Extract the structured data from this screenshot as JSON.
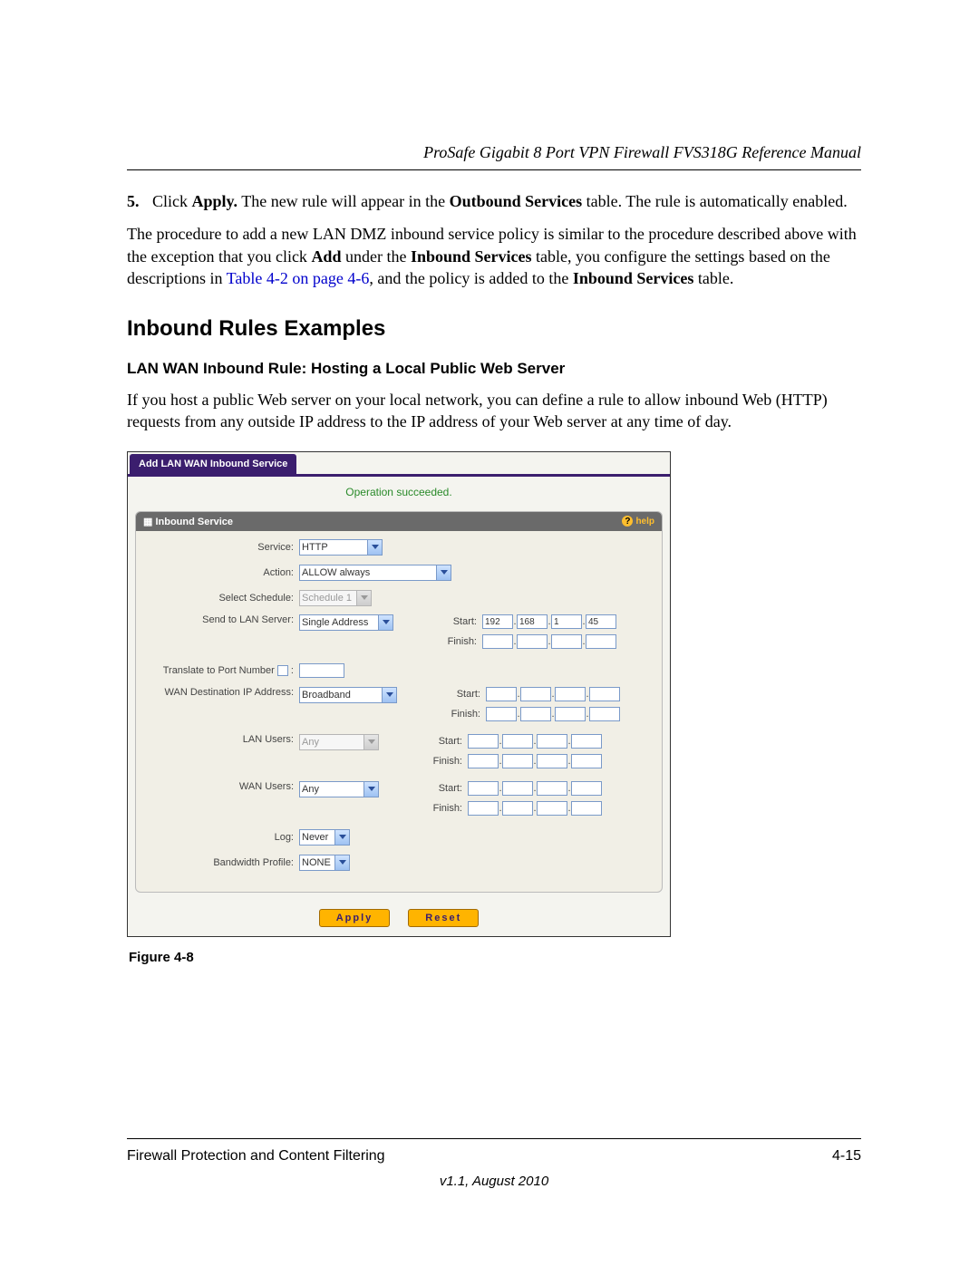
{
  "header": {
    "doc_title": "ProSafe Gigabit 8 Port VPN Firewall FVS318G Reference Manual"
  },
  "step5": {
    "num": "5.",
    "pre": "Click ",
    "apply": "Apply.",
    "mid1": " The new rule will appear in the ",
    "outbound": "Outbound Services",
    "mid2": " table. The rule is automatically enabled."
  },
  "para": {
    "pre": "The procedure to add a new LAN DMZ inbound service policy is similar to the procedure described above with the exception that you click ",
    "add": "Add",
    "mid1": " under the ",
    "inbound1": "Inbound Services",
    "mid2": " table, you configure the settings based on the descriptions in ",
    "link": "Table 4-2 on page 4-6",
    "mid3": ", and the policy is added to the ",
    "inbound2": "Inbound Services",
    "mid4": " table."
  },
  "h1": "Inbound Rules Examples",
  "h2": "LAN WAN Inbound Rule: Hosting a Local Public Web Server",
  "para2": "If you host a public Web server on your local network, you can define a rule to allow inbound Web (HTTP) requests from any outside IP address to the IP address of your Web server at any time of day.",
  "fig_caption": "Figure 4-8",
  "shot": {
    "tab": "Add LAN WAN Inbound Service",
    "status": "Operation succeeded.",
    "panel_title": "Inbound Service",
    "help": "help",
    "labels": {
      "service": "Service:",
      "action": "Action:",
      "schedule": "Select Schedule:",
      "sendto": "Send to LAN Server:",
      "translate": "Translate to Port Number",
      "wandest": "WAN Destination IP Address:",
      "lanusers": "LAN Users:",
      "wanusers": "WAN Users:",
      "log": "Log:",
      "bw": "Bandwidth Profile:",
      "start": "Start:",
      "finish": "Finish:"
    },
    "values": {
      "service": "HTTP",
      "action": "ALLOW always",
      "schedule": "Schedule 1",
      "sendto": "Single Address",
      "wandest": "Broadband",
      "lanusers": "Any",
      "wanusers": "Any",
      "log": "Never",
      "bw": "NONE",
      "ip": [
        "192",
        "168",
        "1",
        "45"
      ]
    },
    "buttons": {
      "apply": "Apply",
      "reset": "Reset"
    }
  },
  "footer": {
    "left": "Firewall Protection and Content Filtering",
    "right": "4-15",
    "ver": "v1.1, August 2010"
  }
}
